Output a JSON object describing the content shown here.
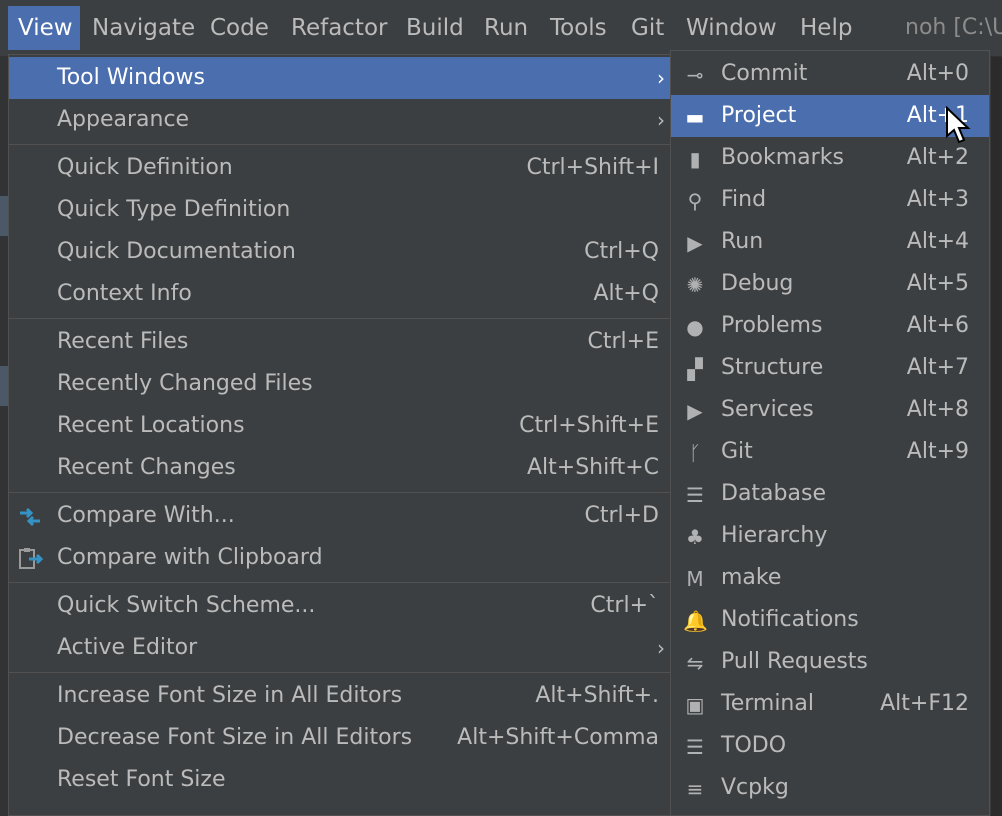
{
  "menubar": {
    "items": [
      {
        "label": "View",
        "active": true
      },
      {
        "label": "Navigate"
      },
      {
        "label": "Code"
      },
      {
        "label": "Refactor"
      },
      {
        "label": "Build"
      },
      {
        "label": "Run"
      },
      {
        "label": "Tools"
      },
      {
        "label": "Git"
      },
      {
        "label": "Window"
      },
      {
        "label": "Help"
      }
    ],
    "title": "noh [C:\\U"
  },
  "view_menu": {
    "items": [
      {
        "label": "Tool Windows",
        "shortcut": "",
        "submenu": true,
        "highlighted": true
      },
      {
        "label": "Appearance",
        "shortcut": "",
        "submenu": true
      },
      {
        "label": "Quick Definition",
        "shortcut": "Ctrl+Shift+I"
      },
      {
        "label": "Quick Type Definition",
        "shortcut": ""
      },
      {
        "label": "Quick Documentation",
        "shortcut": "Ctrl+Q"
      },
      {
        "label": "Context Info",
        "shortcut": "Alt+Q"
      },
      {
        "label": "Recent Files",
        "shortcut": "Ctrl+E"
      },
      {
        "label": "Recently Changed Files",
        "shortcut": ""
      },
      {
        "label": "Recent Locations",
        "shortcut": "Ctrl+Shift+E"
      },
      {
        "label": "Recent Changes",
        "shortcut": "Alt+Shift+C"
      },
      {
        "label": "Compare With...",
        "shortcut": "Ctrl+D",
        "icon": "compare-icon"
      },
      {
        "label": "Compare with Clipboard",
        "shortcut": "",
        "icon": "compare-clipboard-icon"
      },
      {
        "label": "Quick Switch Scheme...",
        "shortcut": "Ctrl+`"
      },
      {
        "label": "Active Editor",
        "shortcut": "",
        "submenu": true
      },
      {
        "label": "Increase Font Size in All Editors",
        "shortcut": "Alt+Shift+."
      },
      {
        "label": "Decrease Font Size in All Editors",
        "shortcut": "Alt+Shift+Comma"
      },
      {
        "label": "Reset Font Size",
        "shortcut": ""
      }
    ],
    "submenu_arrow": "›"
  },
  "tool_windows": {
    "items": [
      {
        "label": "Commit",
        "shortcut": "Alt+0",
        "icon": "commit-icon",
        "glyph": "⊸"
      },
      {
        "label": "Project",
        "shortcut": "Alt+1",
        "icon": "folder-icon",
        "glyph": "▬",
        "highlighted": true
      },
      {
        "label": "Bookmarks",
        "shortcut": "Alt+2",
        "icon": "bookmark-icon",
        "glyph": "▮"
      },
      {
        "label": "Find",
        "shortcut": "Alt+3",
        "icon": "search-icon",
        "glyph": "⚲"
      },
      {
        "label": "Run",
        "shortcut": "Alt+4",
        "icon": "run-icon",
        "glyph": "▶"
      },
      {
        "label": "Debug",
        "shortcut": "Alt+5",
        "icon": "bug-icon",
        "glyph": "✺"
      },
      {
        "label": "Problems",
        "shortcut": "Alt+6",
        "icon": "problems-icon",
        "glyph": "●"
      },
      {
        "label": "Structure",
        "shortcut": "Alt+7",
        "icon": "structure-icon",
        "glyph": "▞"
      },
      {
        "label": "Services",
        "shortcut": "Alt+8",
        "icon": "services-icon",
        "glyph": "▶"
      },
      {
        "label": "Git",
        "shortcut": "Alt+9",
        "icon": "git-branch-icon",
        "glyph": "ᚴ"
      },
      {
        "label": "Database",
        "shortcut": "",
        "icon": "database-icon",
        "glyph": "☰"
      },
      {
        "label": "Hierarchy",
        "shortcut": "",
        "icon": "hierarchy-icon",
        "glyph": "♣"
      },
      {
        "label": "make",
        "shortcut": "",
        "icon": "make-icon",
        "glyph": "M"
      },
      {
        "label": "Notifications",
        "shortcut": "",
        "icon": "bell-icon",
        "glyph": "🔔"
      },
      {
        "label": "Pull Requests",
        "shortcut": "",
        "icon": "pull-request-icon",
        "glyph": "⇋"
      },
      {
        "label": "Terminal",
        "shortcut": "Alt+F12",
        "icon": "terminal-icon",
        "glyph": "▣"
      },
      {
        "label": "TODO",
        "shortcut": "",
        "icon": "todo-icon",
        "glyph": "☰"
      },
      {
        "label": "Vcpkg",
        "shortcut": "",
        "icon": "vcpkg-icon",
        "glyph": "≡"
      }
    ]
  },
  "colors": {
    "menu_bg": "#3c3f41",
    "highlight": "#4b6eaf",
    "text": "#bbbbbb",
    "separator": "#515151",
    "accent_icon": "#3592c4"
  }
}
